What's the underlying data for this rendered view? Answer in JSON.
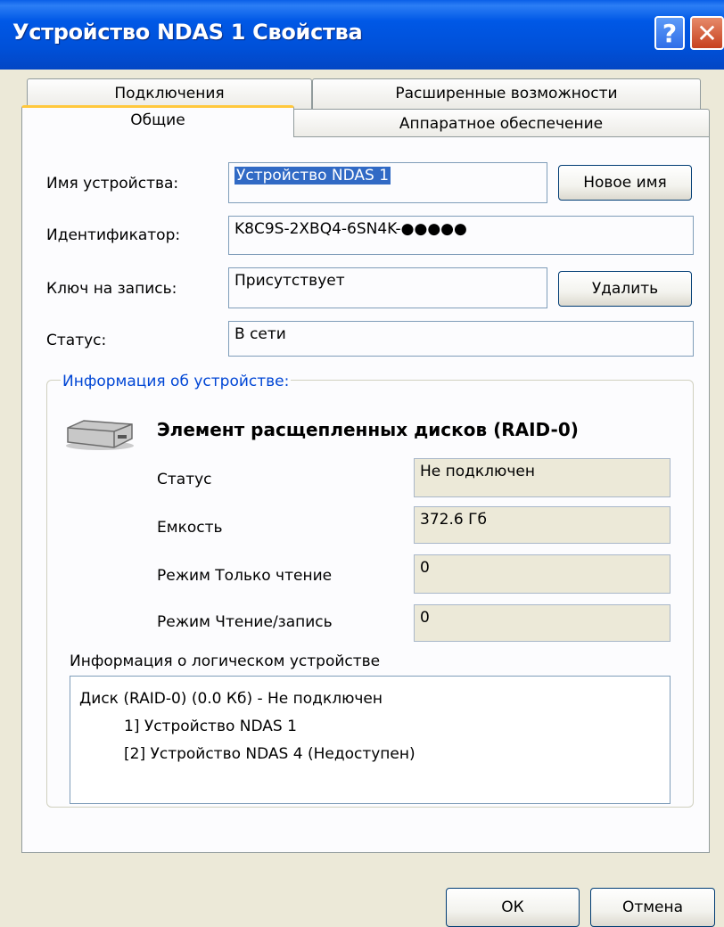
{
  "window": {
    "title": "Устройство NDAS 1 Свойства",
    "help_glyph": "?",
    "close_glyph": "✕"
  },
  "tabs": {
    "row1": [
      "Подключения",
      "Расширенные возможности"
    ],
    "row2": [
      "Общие",
      "Аппаратное обеспечение"
    ],
    "active": "Общие"
  },
  "general": {
    "name_label": "Имя устройства:",
    "name_value": "Устройство NDAS 1",
    "rename_button": "Новое имя",
    "id_label": "Идентификатор:",
    "id_value": "K8C9S-2XBQ4-6SN4K-●●●●●",
    "key_label": "Ключ на запись:",
    "key_value": "Присутствует",
    "delete_button": "Удалить",
    "status_label": "Статус:",
    "status_value": "В сети"
  },
  "device_info": {
    "group_title": "Информация об устройстве:",
    "device_type": "Элемент расщепленных дисков (RAID-0)",
    "rows": [
      {
        "label": "Статус",
        "value": "Не подключен"
      },
      {
        "label": "Емкость",
        "value": "372.6 Гб"
      },
      {
        "label": "Режим Только чтение",
        "value": "0"
      },
      {
        "label": "Режим Чтение/запись",
        "value": "0"
      }
    ],
    "logical_label": "Информация о логическом устройстве",
    "logical_lines": [
      "Диск (RAID-0) (0.0 Кб) - Не подключен",
      "1] Устройство NDAS 1",
      "[2] Устройство NDAS 4 (Недоступен)"
    ]
  },
  "footer": {
    "ok_button": "ОК",
    "cancel_button": "Отмена"
  },
  "icons": {
    "drive": "hard-drive-icon"
  }
}
